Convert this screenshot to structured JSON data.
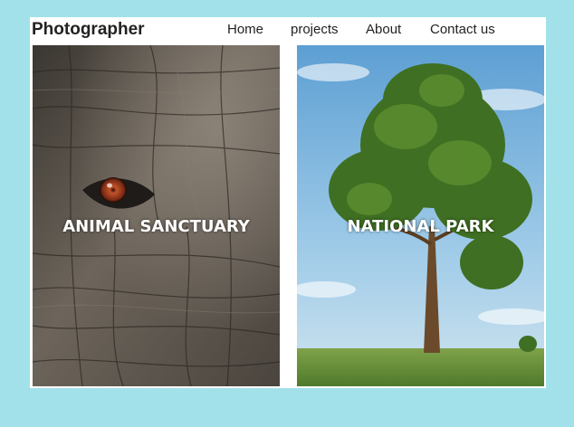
{
  "brand": {
    "name": "Photographer"
  },
  "nav": {
    "items": [
      {
        "label": "Home"
      },
      {
        "label": "projects"
      },
      {
        "label": "About"
      },
      {
        "label": "Contact us"
      }
    ]
  },
  "gallery": {
    "cards": [
      {
        "title": "ANIMAL SANCTUARY",
        "image": "elephant-eye-closeup"
      },
      {
        "title": "NATIONAL PARK",
        "image": "tree-in-field"
      }
    ]
  },
  "colors": {
    "page_background": "#a2e1e9",
    "frame_background": "#ffffff",
    "text": "#222222",
    "caption": "#ffffff"
  }
}
